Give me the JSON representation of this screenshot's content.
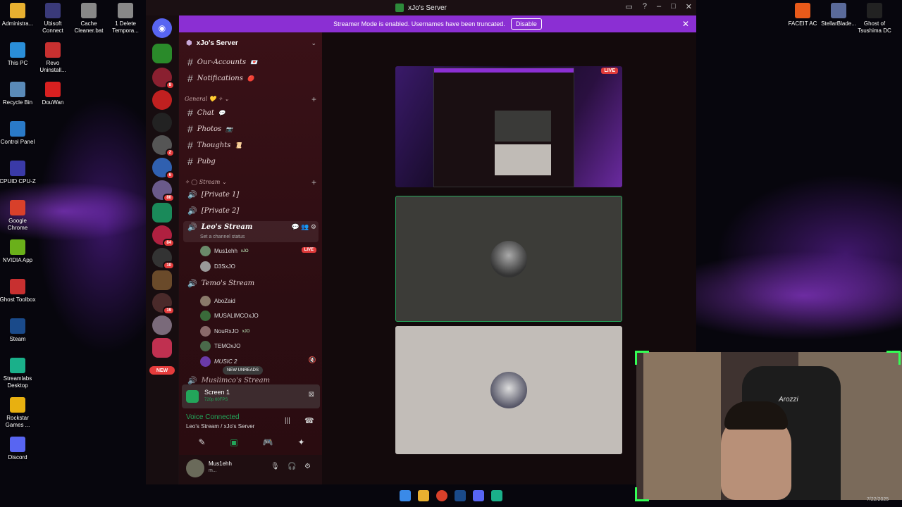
{
  "desktop": {
    "left_icons": [
      {
        "label": "Administra...",
        "color": "#e8b030"
      },
      {
        "label": "This PC",
        "color": "#2a8ed8"
      },
      {
        "label": "Recycle Bin",
        "color": "#5a8ab8"
      },
      {
        "label": "Control Panel",
        "color": "#2a7ac8"
      },
      {
        "label": "CPUID CPU-Z",
        "color": "#3a3aa8"
      },
      {
        "label": "Google Chrome",
        "color": "#d8402a"
      },
      {
        "label": "NVIDIA App",
        "color": "#6ab01a"
      },
      {
        "label": "Ghost Toolbox",
        "color": "#c83030"
      },
      {
        "label": "Steam",
        "color": "#1a4a8a"
      },
      {
        "label": "Streamlabs Desktop",
        "color": "#1ab08a"
      },
      {
        "label": "Rockstar Games ...",
        "color": "#e8b010"
      },
      {
        "label": "Discord",
        "color": "#5865f2"
      }
    ],
    "second_col_icons": [
      {
        "label": "Ubisoft Connect",
        "color": "#3a3a7a"
      },
      {
        "label": "Revo Uninstall...",
        "color": "#c83030"
      },
      {
        "label": "DouWan",
        "color": "#d82020"
      }
    ],
    "top_icons": [
      {
        "label": "Cache Cleaner.bat",
        "color": "#888"
      },
      {
        "label": "1 Delete Tempora...",
        "color": "#888"
      }
    ],
    "right_icons": [
      {
        "label": "FACEIT AC",
        "color": "#e85a1a"
      },
      {
        "label": "StellarBlade...",
        "color": "#5a6a9a"
      },
      {
        "label": "Ghost of Tsushima DC",
        "color": "#222"
      }
    ],
    "clock": "7/22/2025"
  },
  "window": {
    "title": "xJo's Server"
  },
  "banner": {
    "text": "Streamer Mode is enabled. Usernames have been truncated.",
    "button": "Disable"
  },
  "server": {
    "name": "xJo's Server",
    "channels_top": [
      {
        "name": "Our-Accounts",
        "emoji": "💌"
      },
      {
        "name": "Notifications",
        "emoji": "🔴"
      }
    ],
    "category_general": "General",
    "channels_general": [
      {
        "name": "Chat",
        "emoji": "💬"
      },
      {
        "name": "Photos",
        "emoji": "📷"
      },
      {
        "name": "Thoughts",
        "emoji": "📜"
      },
      {
        "name": "Pubg",
        "emoji": ""
      }
    ],
    "category_stream": "Stream",
    "voice_channels": [
      "[Private 1]",
      "[Private 2]"
    ],
    "active_voice": {
      "name": "Leo's Stream",
      "status": "Set a channel status",
      "users": [
        {
          "name": "Mus1ehh",
          "tag": "xJO",
          "live": "LIVE"
        },
        {
          "name": "D3SxJO",
          "tag": "",
          "live": ""
        }
      ]
    },
    "second_voice": {
      "name": "Temo's Stream",
      "users": [
        {
          "name": "AboZaid",
          "tag": ""
        },
        {
          "name": "MUSALIMCOxJO",
          "tag": ""
        },
        {
          "name": "NouRxJO",
          "tag": "xJO"
        },
        {
          "name": "TEMOxJO",
          "tag": ""
        },
        {
          "name": "MUSIC 2",
          "tag": ""
        }
      ]
    },
    "new_unreads": "NEW UNREADS",
    "next_channel": "Muslimco's Stream"
  },
  "guild_badges": [
    "8",
    "2",
    "6",
    "80",
    "84",
    "10",
    "19"
  ],
  "guild_new": "NEW",
  "screen_share": {
    "title": "Screen 1",
    "quality": "720p 60FPS"
  },
  "voice": {
    "status": "Voice Connected",
    "location": "Leo's Stream / xJo's Server"
  },
  "user_panel": {
    "name": "Mus1ehh",
    "sub": "m..."
  },
  "stream_tiles": {
    "live_label": "LIVE"
  },
  "webcam": {
    "chair_brand": "Arozzi"
  }
}
